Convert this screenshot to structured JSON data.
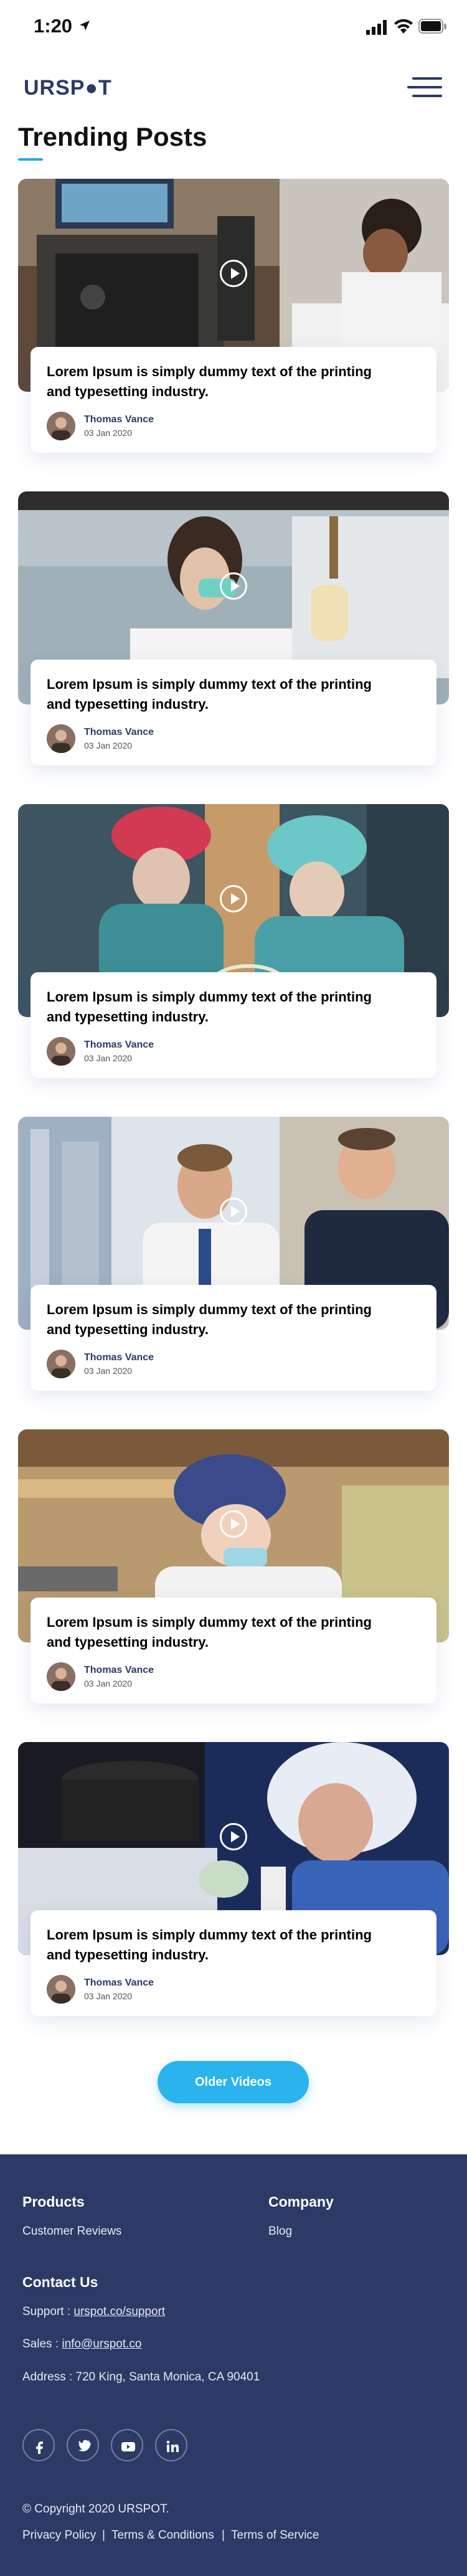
{
  "status_bar": {
    "time": "1:20"
  },
  "header": {
    "logo": "URSP●T"
  },
  "page": {
    "title": "Trending Posts"
  },
  "posts": [
    {
      "text": "Lorem Ipsum is simply dummy text of the printing and typesetting industry.",
      "author": "Thomas Vance",
      "date": "03 Jan 2020"
    },
    {
      "text": "Lorem Ipsum is simply dummy text of the printing and typesetting industry.",
      "author": "Thomas Vance",
      "date": "03 Jan 2020"
    },
    {
      "text": "Lorem Ipsum is simply dummy text of the printing and typesetting industry.",
      "author": "Thomas Vance",
      "date": "03 Jan 2020"
    },
    {
      "text": "Lorem Ipsum is simply dummy text of the printing and typesetting industry.",
      "author": "Thomas Vance",
      "date": "03 Jan 2020"
    },
    {
      "text": "Lorem Ipsum is simply dummy text of the printing and typesetting industry.",
      "author": "Thomas Vance",
      "date": "03 Jan 2020"
    },
    {
      "text": "Lorem Ipsum is simply dummy text of the printing and typesetting industry.",
      "author": "Thomas Vance",
      "date": "03 Jan 2020"
    }
  ],
  "older_button": "Older Videos",
  "footer": {
    "products_heading": "Products",
    "products_link": "Customer Reviews",
    "company_heading": "Company",
    "company_link": "Blog",
    "contact_heading": "Contact Us",
    "support_label": "Support : ",
    "support_value": "urspot.co/support",
    "sales_label": "Sales : ",
    "sales_value": "info@urspot.co",
    "address_label": "Address : ",
    "address_value": "720 King, Santa Monica, CA 90401",
    "social": [
      "facebook-icon",
      "twitter-icon",
      "youtube-icon",
      "linkedin-icon"
    ],
    "copyright": "© Copyright 2020 URSPOT.",
    "privacy": "Privacy Policy",
    "terms": "Terms & Conditions",
    "tos": "Terms of Service",
    "separator": "|"
  },
  "colors": {
    "brand": "#2d3a66",
    "accent": "#2ab3ec"
  }
}
